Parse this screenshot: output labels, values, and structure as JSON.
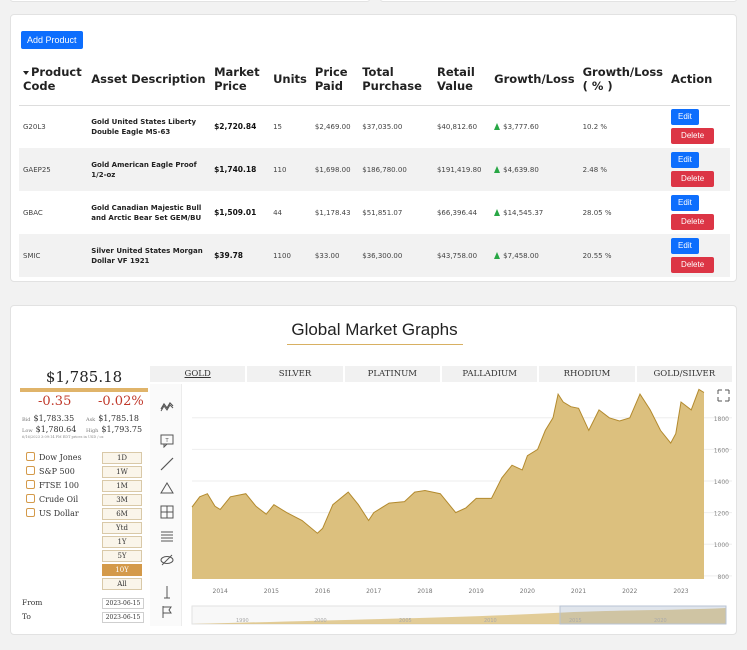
{
  "products": {
    "add_label": "Add Product",
    "headers": [
      "Product Code",
      "Asset Description",
      "Market Price",
      "Units",
      "Price Paid",
      "Total Purchase",
      "Retail Value",
      "Growth/Loss",
      "Growth/Loss ( % )",
      "Action"
    ],
    "edit_label": "Edit",
    "delete_label": "Delete",
    "rows": [
      {
        "code": "G20L3",
        "desc": "Gold United States Liberty Double Eagle MS-63",
        "market": "$2,720.84",
        "units": "15",
        "paid": "$2,469.00",
        "total": "$37,035.00",
        "retail": "$40,812.60",
        "growth": "$3,777.60",
        "pct": "10.2 %"
      },
      {
        "code": "GAEP25",
        "desc": "Gold American Eagle Proof 1/2-oz",
        "market": "$1,740.18",
        "units": "110",
        "paid": "$1,698.00",
        "total": "$186,780.00",
        "retail": "$191,419.80",
        "growth": "$4,639.80",
        "pct": "2.48 %"
      },
      {
        "code": "GBAC",
        "desc": "Gold Canadian Majestic Bull and Arctic Bear Set GEM/BU",
        "market": "$1,509.01",
        "units": "44",
        "paid": "$1,178.43",
        "total": "$51,851.07",
        "retail": "$66,396.44",
        "growth": "$14,545.37",
        "pct": "28.05 %"
      },
      {
        "code": "SMIC",
        "desc": "Silver United States Morgan Dollar VF 1921",
        "market": "$39.78",
        "units": "1100",
        "paid": "$33.00",
        "total": "$36,300.00",
        "retail": "$43,758.00",
        "growth": "$7,458.00",
        "pct": "20.55 %"
      }
    ]
  },
  "graphs": {
    "title": "Global Market Graphs",
    "quote": {
      "price": "$1,785.18",
      "change": "-0.35",
      "change_pct": "-0.02%",
      "bid_label": "Bid",
      "bid": "$1,783.35",
      "ask_label": "Ask",
      "ask": "$1,785.18",
      "low_label": "Low",
      "low": "$1,780.64",
      "high_label": "High",
      "high": "$1,793.75",
      "note": "6/16/2023 3:09:14 PM EDT     prices in USD / oz"
    },
    "indices": [
      "Dow Jones",
      "S&P 500",
      "FTSE 100",
      "Crude Oil",
      "US Dollar"
    ],
    "ranges": [
      "1D",
      "1W",
      "1M",
      "3M",
      "6M",
      "Ytd",
      "1Y",
      "5Y",
      "10Y",
      "All"
    ],
    "selected_range": "10Y",
    "from_label": "From",
    "from": "2023-06-15",
    "to_label": "To",
    "to": "2023-06-15",
    "tabs": [
      "GOLD",
      "SILVER",
      "PLATINUM",
      "PALLADIUM",
      "RHODIUM",
      "GOLD/SILVER"
    ],
    "active_tab": "GOLD",
    "nav_years": [
      "1990",
      "2000",
      "2005",
      "2010",
      "2015",
      "2020"
    ],
    "colors": {
      "accent": "#d49a4a",
      "area_fill": "#dcc07e",
      "area_stroke": "#b38a2e",
      "blue": "#0d6efd",
      "red": "#dc3545",
      "green": "#28a745"
    }
  },
  "chart_data": {
    "type": "area",
    "x_ticks": [
      "2014",
      "2015",
      "2016",
      "2017",
      "2018",
      "2019",
      "2020",
      "2021",
      "2022",
      "2023"
    ],
    "y_ticks": [
      800,
      1000,
      1200,
      1400,
      1600,
      1800
    ],
    "ylim": [
      780,
      1900
    ],
    "xlim": [
      2013.45,
      2023.45
    ],
    "x": [
      2013.45,
      2013.6,
      2013.75,
      2013.9,
      2014.0,
      2014.2,
      2014.5,
      2014.7,
      2014.9,
      2015.05,
      2015.3,
      2015.6,
      2015.9,
      2016.0,
      2016.2,
      2016.5,
      2016.7,
      2016.9,
      2017.0,
      2017.3,
      2017.6,
      2017.8,
      2018.0,
      2018.3,
      2018.6,
      2018.8,
      2019.0,
      2019.3,
      2019.5,
      2019.7,
      2019.9,
      2020.0,
      2020.2,
      2020.35,
      2020.5,
      2020.6,
      2020.7,
      2020.85,
      2021.0,
      2021.2,
      2021.4,
      2021.6,
      2021.8,
      2022.0,
      2022.2,
      2022.4,
      2022.6,
      2022.8,
      2022.9,
      2023.0,
      2023.2,
      2023.35,
      2023.45
    ],
    "values": [
      1235,
      1300,
      1320,
      1240,
      1220,
      1300,
      1320,
      1240,
      1190,
      1250,
      1200,
      1150,
      1070,
      1100,
      1250,
      1330,
      1250,
      1150,
      1200,
      1260,
      1270,
      1330,
      1340,
      1320,
      1200,
      1230,
      1290,
      1290,
      1420,
      1500,
      1470,
      1560,
      1600,
      1720,
      1800,
      1950,
      1900,
      1870,
      1860,
      1720,
      1850,
      1800,
      1780,
      1800,
      1950,
      1850,
      1720,
      1640,
      1700,
      1900,
      1850,
      1980,
      1960
    ]
  }
}
